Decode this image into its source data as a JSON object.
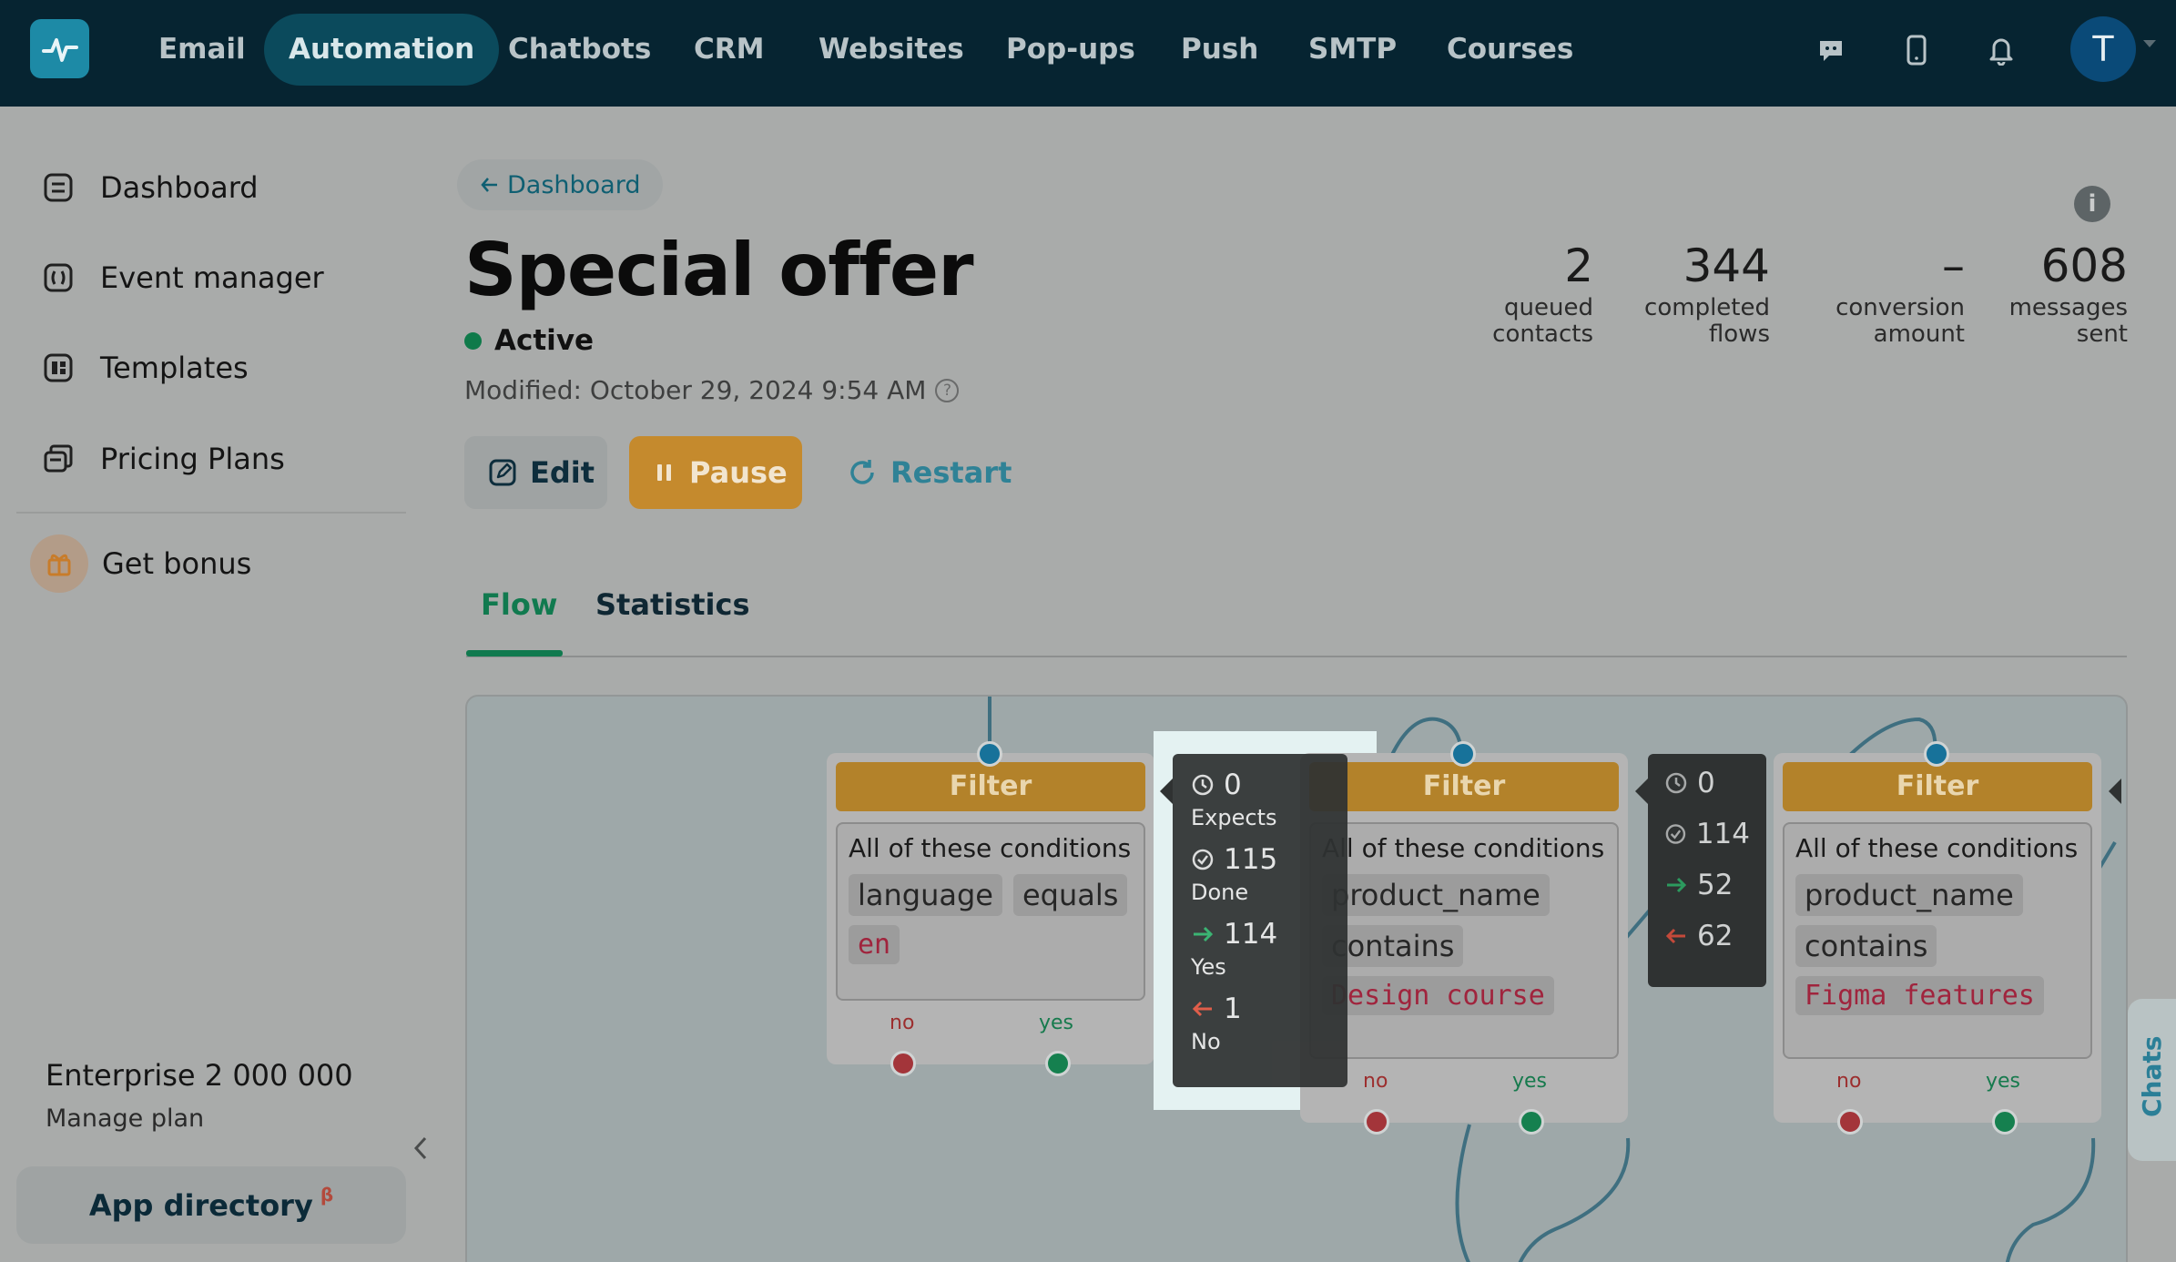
{
  "nav": {
    "items": [
      {
        "label": "Email"
      },
      {
        "label": "Automation"
      },
      {
        "label": "Chatbots"
      },
      {
        "label": "CRM"
      },
      {
        "label": "Websites"
      },
      {
        "label": "Pop-ups"
      },
      {
        "label": "Push"
      },
      {
        "label": "SMTP"
      },
      {
        "label": "Courses"
      }
    ],
    "active": "Automation",
    "avatar_initial": "T"
  },
  "sidebar": {
    "items": [
      {
        "label": "Dashboard",
        "icon": "dashboard-icon"
      },
      {
        "label": "Event manager",
        "icon": "event-icon"
      },
      {
        "label": "Templates",
        "icon": "templates-icon"
      },
      {
        "label": "Pricing Plans",
        "icon": "pricing-icon"
      },
      {
        "label": "Get bonus",
        "icon": "gift-icon"
      }
    ],
    "plan_name": "Enterprise 2 000 000",
    "plan_link": "Manage plan",
    "app_directory": "App directory",
    "app_directory_badge": "β"
  },
  "header": {
    "back_label": "Dashboard",
    "title": "Special offer",
    "status": "Active",
    "modified": "Modified: October 29, 2024 9:54 AM",
    "edit_label": "Edit",
    "pause_label": "Pause",
    "restart_label": "Restart"
  },
  "stats": [
    {
      "value": "2",
      "label1": "queued",
      "label2": "contacts"
    },
    {
      "value": "344",
      "label1": "completed",
      "label2": "flows"
    },
    {
      "value": "–",
      "label1": "conversion",
      "label2": "amount"
    },
    {
      "value": "608",
      "label1": "messages",
      "label2": "sent"
    }
  ],
  "tabs": [
    {
      "label": "Flow"
    },
    {
      "label": "Statistics"
    }
  ],
  "flow": {
    "nodes": [
      {
        "title": "Filter",
        "condition_title": "All of these conditions",
        "chips": [
          "language",
          "equals"
        ],
        "value": "en",
        "no_label": "no",
        "yes_label": "yes"
      },
      {
        "title": "Filter",
        "condition_title": "All of these conditions",
        "chips": [
          "product_name",
          "contains"
        ],
        "value": "Design course",
        "no_label": "no",
        "yes_label": "yes"
      },
      {
        "title": "Filter",
        "condition_title": "All of these conditions",
        "chips": [
          "product_name",
          "contains"
        ],
        "value": "Figma features",
        "no_label": "no",
        "yes_label": "yes"
      }
    ],
    "tooltip_full": {
      "expects": "0",
      "expects_label": "Expects",
      "done": "115",
      "done_label": "Done",
      "yes": "114",
      "yes_label": "Yes",
      "no": "1",
      "no_label": "No"
    },
    "tooltip_compact": {
      "expects": "0",
      "done": "114",
      "yes": "52",
      "no": "62"
    }
  },
  "chats_label": "Chats",
  "colors": {
    "topbar": "#062431",
    "accent_green": "#117a4f",
    "pause": "#c58a2d",
    "filter_header": "#b3822a",
    "no_port": "#a3353a",
    "yes_port": "#15804f",
    "in_port": "#17729a"
  }
}
